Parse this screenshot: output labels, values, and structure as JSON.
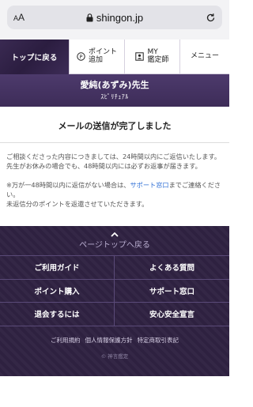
{
  "browser": {
    "text_size_label_small": "A",
    "text_size_label_large": "A",
    "domain": "shingon.jp"
  },
  "nav": {
    "home": "トップに戻る",
    "points_line1": "ポイント",
    "points_line2": "追加",
    "my_line1": "MY",
    "my_line2": "鑑定師",
    "menu": "メニュー"
  },
  "header": {
    "name": "愛純(あずみ)先生",
    "category": "ｽﾋﾟﾘﾁｭｱﾙ"
  },
  "main": {
    "title": "メールの送信が完了しました",
    "para1": "ご相談くださった内容につきましては、24時間以内にご返信いたします。先生がお休みの場合でも、48時間以内には必ずお返事が届きます。",
    "para2_before": "※万が一48時間以内に返信がない場合は、",
    "para2_link": "サポート窓口",
    "para2_after": "までご連絡ください。",
    "para3": "未返信分のポイントを返還させていただきます。"
  },
  "footer": {
    "pagetop": "ページトップへ戻る",
    "grid": [
      "ご利用ガイド",
      "よくある質問",
      "ポイント購入",
      "サポート窓口",
      "退会するには",
      "安心安全宣言"
    ],
    "links": [
      "ご利用規約",
      "個人情報保護方針",
      "特定商取引表記"
    ],
    "copyright": "© 神言鑑定"
  },
  "colors": {
    "brand_purple": "#3d2c58",
    "footer_bg": "#2f2242",
    "link_blue": "#2f6fd6"
  }
}
